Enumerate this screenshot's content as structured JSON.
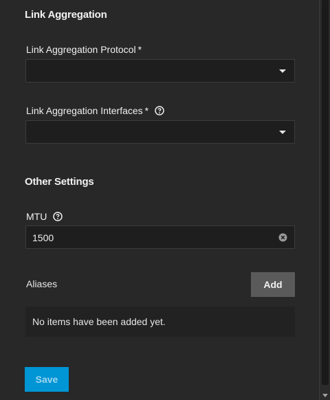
{
  "sections": {
    "link_aggregation": "Link Aggregation",
    "other_settings": "Other Settings"
  },
  "fields": {
    "lag_protocol": {
      "label": "Link Aggregation Protocol",
      "required_mark": "*",
      "value": "",
      "icon": "chevron-down-icon"
    },
    "lag_interfaces": {
      "label": "Link Aggregation Interfaces",
      "required_mark": "*",
      "help_icon": "help-circle-icon",
      "value": "",
      "icon": "chevron-down-icon"
    },
    "mtu": {
      "label": "MTU",
      "help_icon": "help-circle-icon",
      "value": "1500",
      "clear_icon": "clear-circle-icon"
    }
  },
  "aliases": {
    "label": "Aliases",
    "add_label": "Add",
    "empty_text": "No items have been added yet."
  },
  "actions": {
    "save_label": "Save"
  },
  "colors": {
    "panel_bg": "#282828",
    "input_bg": "#1e1e1e",
    "primary": "#0095d5",
    "secondary_button": "#5a5a5a"
  }
}
